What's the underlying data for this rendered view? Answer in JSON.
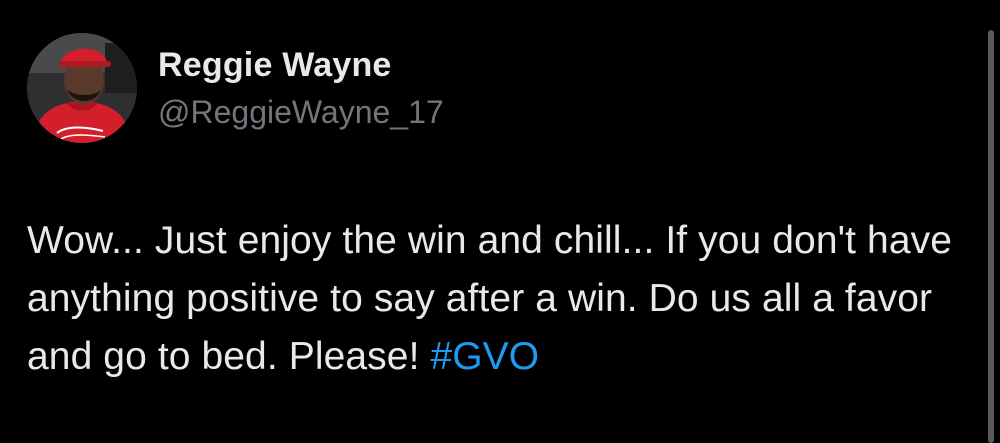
{
  "author": {
    "display_name": "Reggie Wayne",
    "handle": "@ReggieWayne_17"
  },
  "tweet": {
    "text": "Wow... Just enjoy the win and chill... If you don't have anything positive to say after a win. Do us all a favor and go to bed. Please! ",
    "hashtag": "#GVO"
  },
  "colors": {
    "background": "#000000",
    "primary_text": "#e7e9ea",
    "secondary_text": "#71767b",
    "link": "#1d9bf0"
  },
  "icons": {
    "avatar": "profile-photo"
  }
}
